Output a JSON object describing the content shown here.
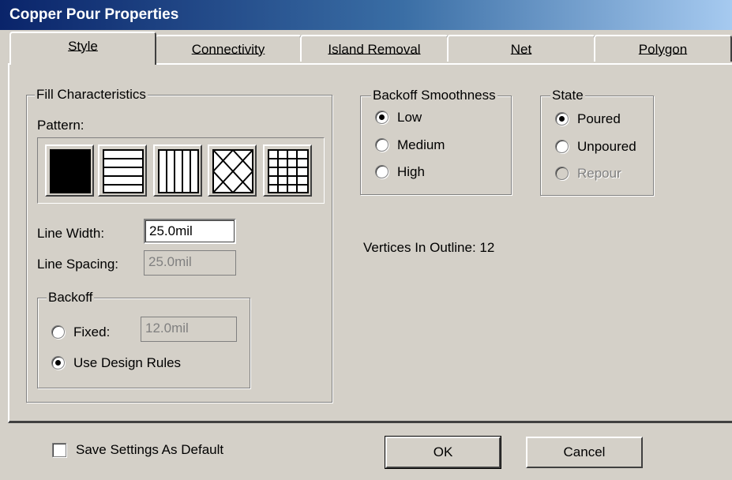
{
  "window": {
    "title": "Copper Pour Properties"
  },
  "tabs": [
    {
      "label": "Style",
      "active": true
    },
    {
      "label": "Connectivity",
      "active": false
    },
    {
      "label": "Island Removal",
      "active": false
    },
    {
      "label": "Net",
      "active": false
    },
    {
      "label": "Polygon",
      "active": false
    }
  ],
  "fill": {
    "group_label": "Fill Characteristics",
    "pattern_label": "Pattern:",
    "patterns": [
      "solid-pattern-icon",
      "horizontal-lines-pattern-icon",
      "vertical-lines-pattern-icon",
      "diagonal-crosshatch-pattern-icon",
      "grid-pattern-icon"
    ],
    "selected_pattern": 0,
    "line_width_label": "Line Width:",
    "line_width_value": "25.0mil",
    "line_spacing_label": "Line Spacing:",
    "line_spacing_value": "25.0mil"
  },
  "backoff": {
    "group_label": "Backoff",
    "fixed_label": "Fixed:",
    "fixed_value": "12.0mil",
    "design_rules_label": "Use Design Rules",
    "selected": "design_rules"
  },
  "smoothness": {
    "group_label": "Backoff Smoothness",
    "options": [
      "Low",
      "Medium",
      "High"
    ],
    "selected": "Low"
  },
  "state": {
    "group_label": "State",
    "options": [
      "Poured",
      "Unpoured",
      "Repour"
    ],
    "selected": "Poured",
    "disabled": [
      "Repour"
    ]
  },
  "vertices_text": "Vertices In Outline: 12",
  "footer": {
    "save_default_label": "Save Settings As Default",
    "save_default_checked": false,
    "ok_label": "OK",
    "cancel_label": "Cancel"
  }
}
